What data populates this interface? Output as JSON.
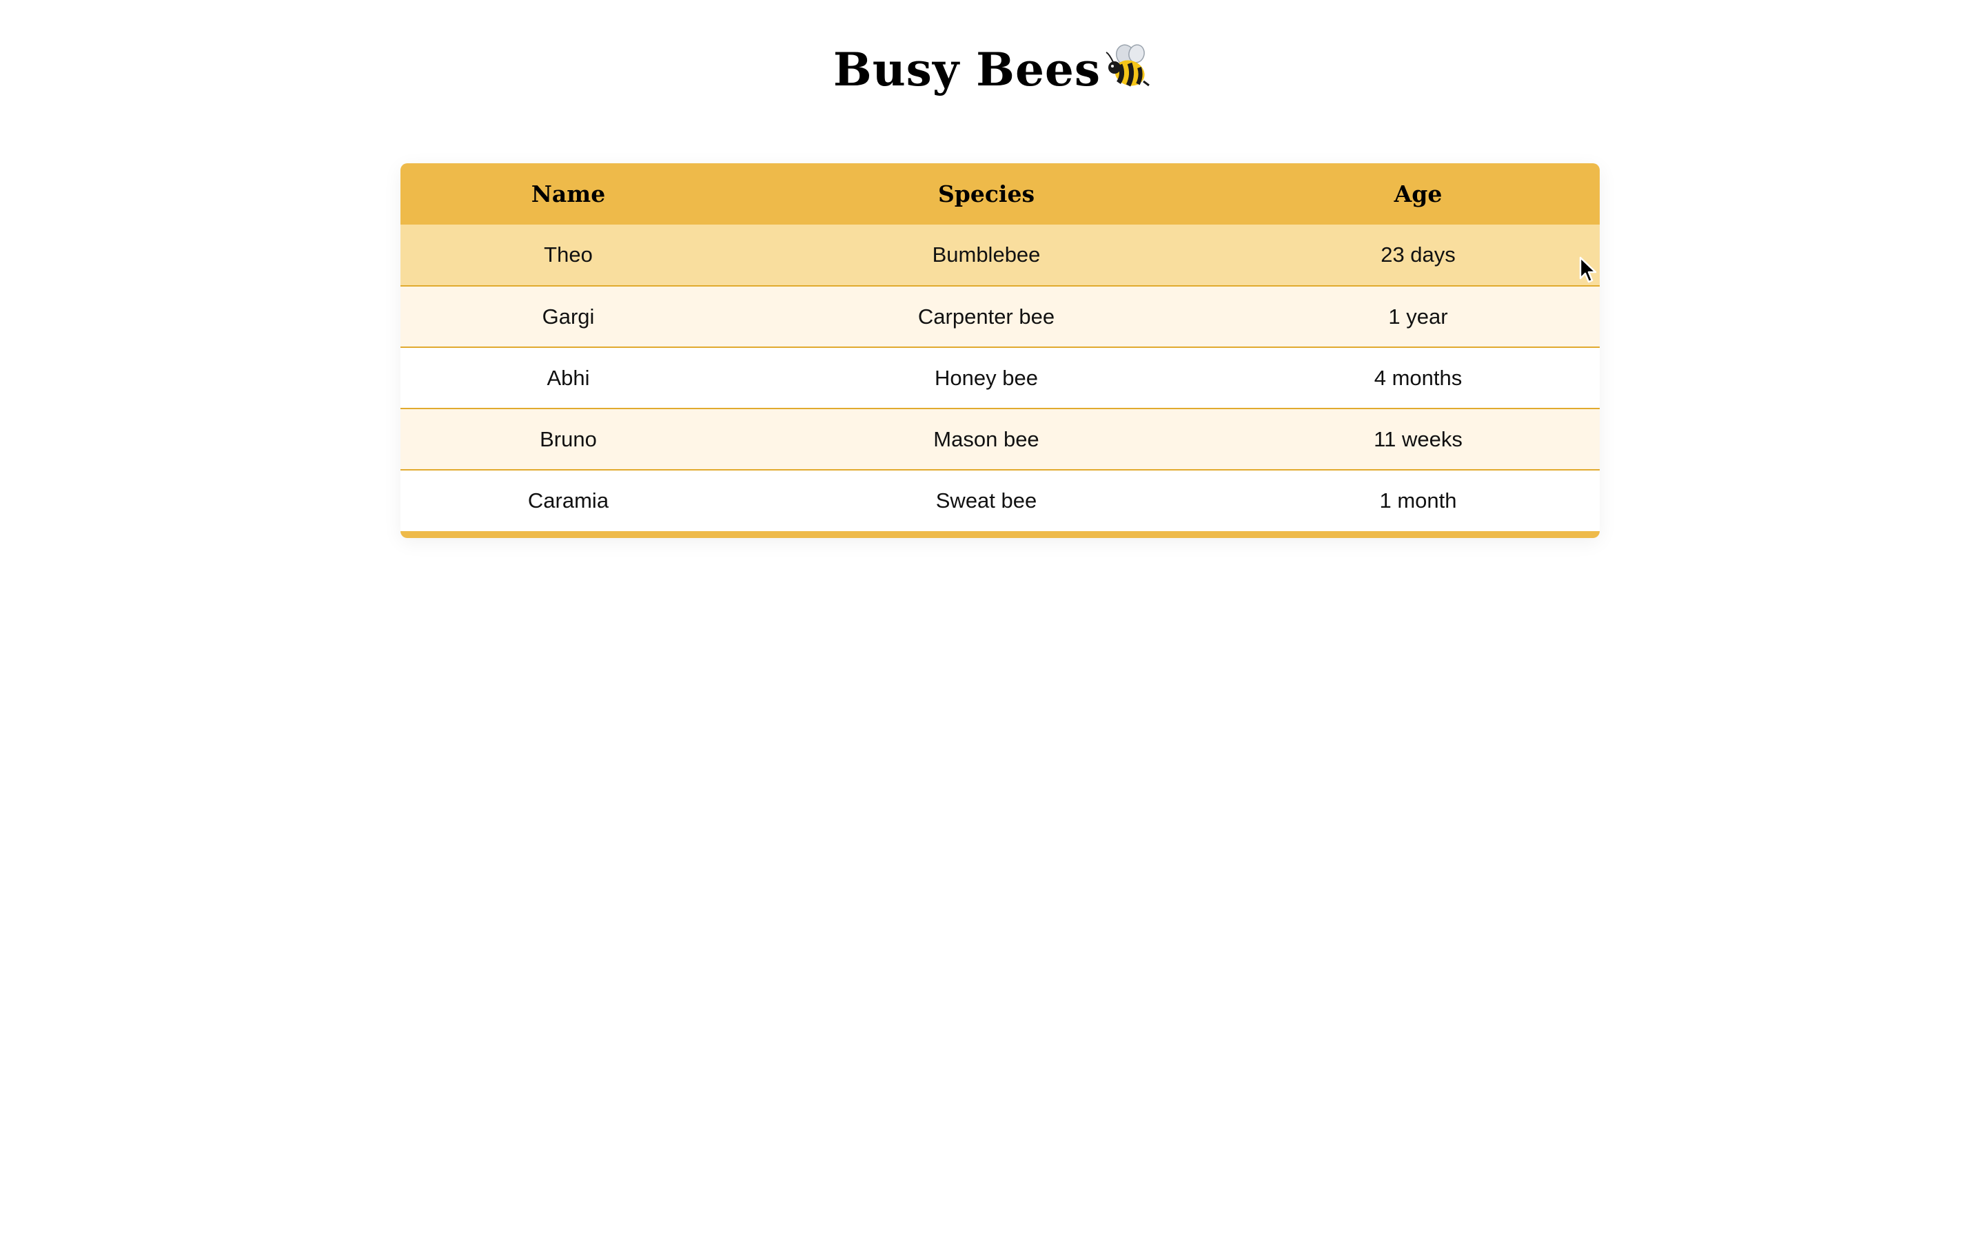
{
  "page": {
    "title": "Busy Bees",
    "title_icon": "bee-icon"
  },
  "table": {
    "headers": [
      "Name",
      "Species",
      "Age"
    ],
    "rows": [
      {
        "name": "Theo",
        "species": "Bumblebee",
        "age": "23 days"
      },
      {
        "name": "Gargi",
        "species": "Carpenter bee",
        "age": "1 year"
      },
      {
        "name": "Abhi",
        "species": "Honey bee",
        "age": "4 months"
      },
      {
        "name": "Bruno",
        "species": "Mason bee",
        "age": "11 weeks"
      },
      {
        "name": "Caramia",
        "species": "Sweat bee",
        "age": "1 month"
      }
    ],
    "hovered_row": 0
  },
  "colors": {
    "header_bg": "#eeba4a",
    "hover_row_bg": "#f9de9e",
    "alt_row_bg": "#fff6e7",
    "row_border": "#e1aa2e"
  }
}
